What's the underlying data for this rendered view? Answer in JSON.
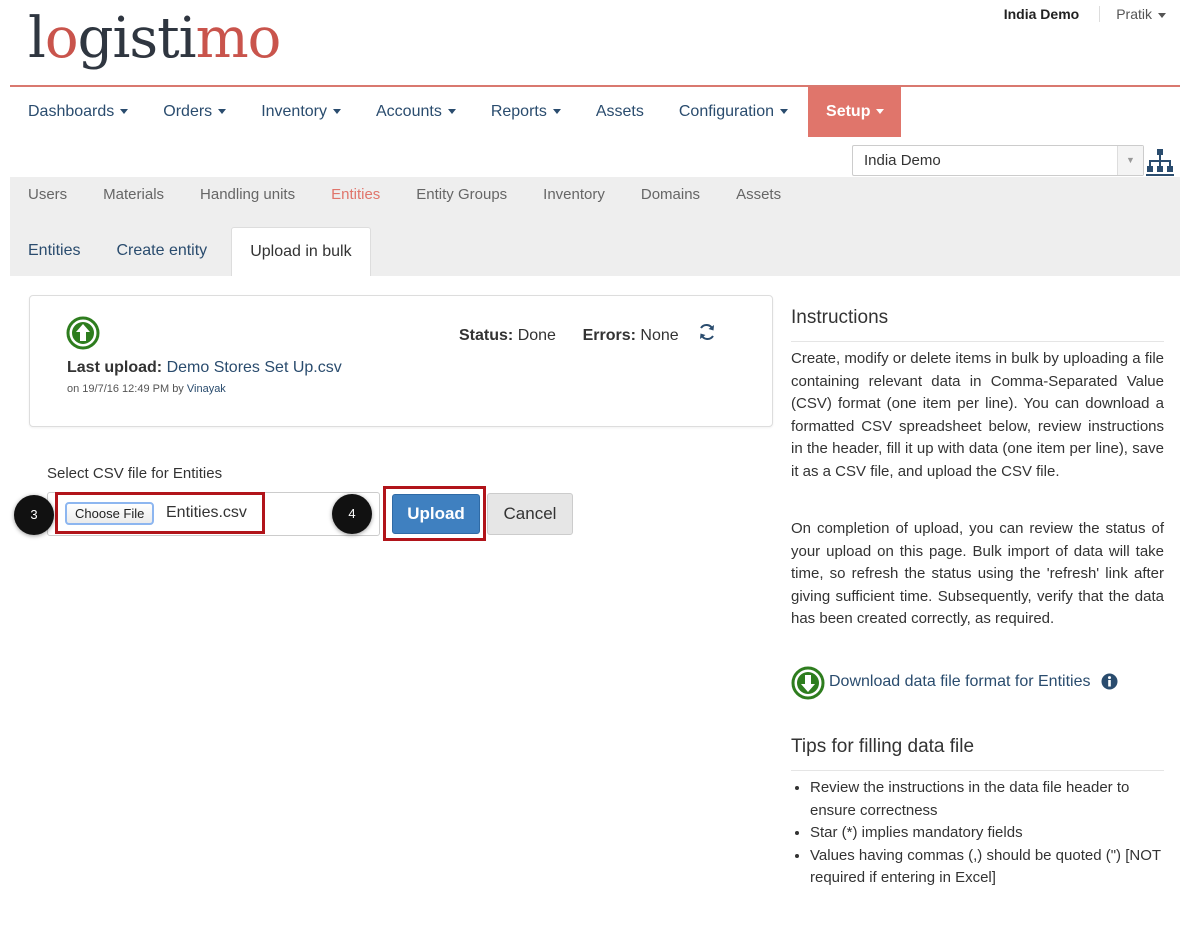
{
  "header": {
    "logo": {
      "pre": "l",
      "o1": "o",
      "mid": "gisti",
      "o2": "mo"
    },
    "domain_link": "India Demo",
    "user_link": "Pratik"
  },
  "main_nav": {
    "items": [
      "Dashboards",
      "Orders",
      "Inventory",
      "Accounts",
      "Reports",
      "Assets",
      "Configuration",
      "Setup"
    ]
  },
  "domain_select": {
    "value": "India Demo"
  },
  "sub_nav": {
    "items": [
      "Users",
      "Materials",
      "Handling units",
      "Entities",
      "Entity Groups",
      "Inventory",
      "Domains",
      "Assets"
    ],
    "active": "Entities"
  },
  "tabs": {
    "items": [
      "Entities",
      "Create entity",
      "Upload in bulk"
    ],
    "active": "Upload in bulk"
  },
  "status_panel": {
    "last_upload_label": "Last upload:",
    "last_upload_file": "Demo Stores Set Up.csv",
    "meta_prefix": "on 19/7/16 12:49 PM by ",
    "meta_user": "Vinayak",
    "status_label": "Status:",
    "status_value": "Done",
    "errors_label": "Errors:",
    "errors_value": "None"
  },
  "upload_form": {
    "label": "Select CSV file for Entities",
    "choose_button": "Choose File",
    "file_name": "Entities.csv",
    "upload_button": "Upload",
    "cancel_button": "Cancel",
    "step_3": "3",
    "step_4": "4"
  },
  "instructions": {
    "title": "Instructions",
    "para1": "Create, modify or delete items in bulk by uploading a file containing relevant data in Comma-Separated Value (CSV) format (one item per line). You can download a formatted CSV spreadsheet below, review instructions in the header, fill it up with data (one item per line), save it as a CSV file, and upload the CSV file.",
    "para2": "On completion of upload, you can review the status of your upload on this page. Bulk import of data will take time, so refresh the status using the 'refresh' link after giving sufficient time. Subsequently, verify that the data has been created correctly, as required.",
    "download_link": "Download data file format for Entities"
  },
  "tips": {
    "title": "Tips for filling data file",
    "items": [
      "Review the instructions in the data file header to ensure correctness",
      "Star (*) implies mandatory fields",
      "Values having commas (,) should be quoted (\") [NOT required if entering in Excel]"
    ]
  },
  "colors": {
    "accent": "#e0756b",
    "link": "#2a4c6e",
    "primary_button": "#3f80c0",
    "icon_green": "#2e7d1e",
    "highlight": "#b1141a"
  },
  "icons": {
    "upload": "circle-arrow-up-icon",
    "download": "circle-arrow-down-icon",
    "refresh": "refresh-icon",
    "info": "info-icon",
    "hierarchy": "hierarchy-icon"
  }
}
